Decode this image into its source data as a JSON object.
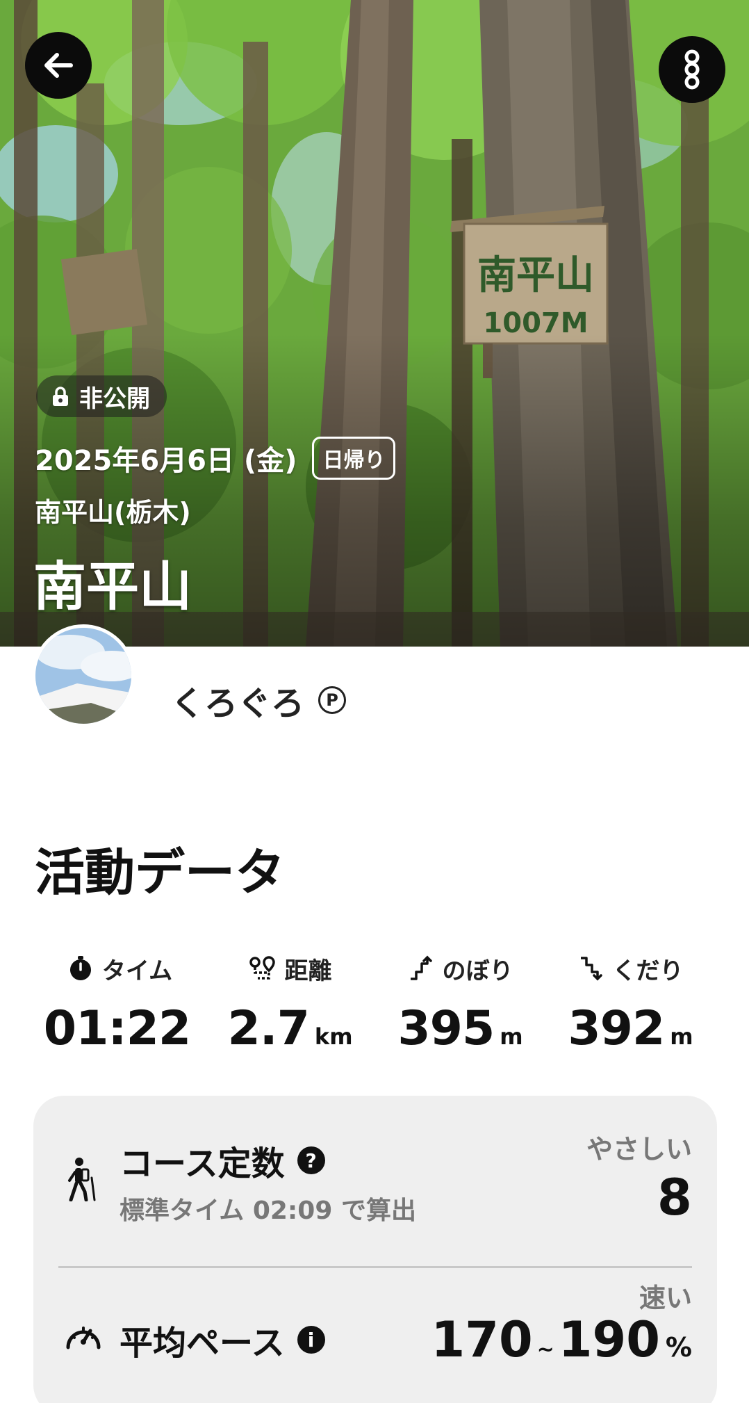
{
  "header": {
    "privacy_label": "非公開",
    "date": "2025年6月6日 (金)",
    "trip_type": "日帰り",
    "mountain_region": "南平山(栃木)",
    "title": "南平山"
  },
  "sign": {
    "name": "南平山",
    "elevation": "1007M"
  },
  "user": {
    "name": "くろぐろ",
    "premium_badge": "P"
  },
  "activity": {
    "section_title": "活動データ",
    "stats": [
      {
        "label": "タイム",
        "value": "01:22",
        "unit": "",
        "icon": "timer-icon"
      },
      {
        "label": "距離",
        "value": "2.7",
        "unit": "km",
        "icon": "distance-icon"
      },
      {
        "label": "のぼり",
        "value": "395",
        "unit": "m",
        "icon": "ascent-icon"
      },
      {
        "label": "くだり",
        "value": "392",
        "unit": "m",
        "icon": "descent-icon"
      }
    ],
    "course_constant": {
      "title": "コース定数",
      "subtitle": "標準タイム 02:09 で算出",
      "level": "やさしい",
      "value": "8"
    },
    "average_pace": {
      "title": "平均ペース",
      "level": "速い",
      "value_low": "170",
      "separator": "~",
      "value_high": "190",
      "unit": "%"
    }
  }
}
